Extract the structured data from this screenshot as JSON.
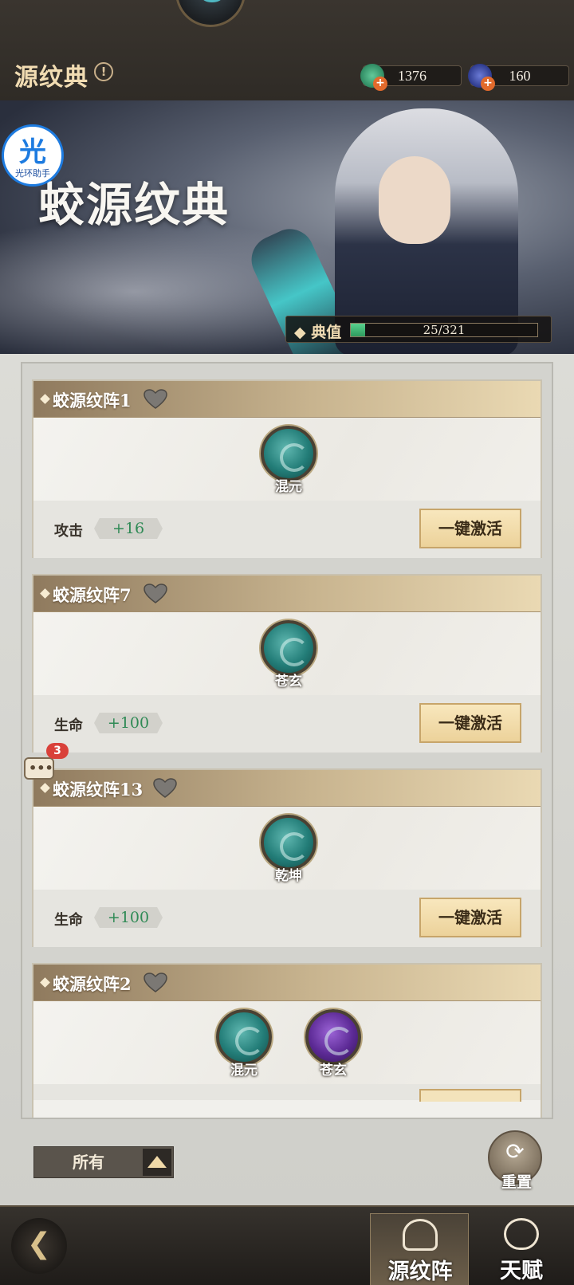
{
  "header": {
    "title": "源纹典",
    "info_icon": "!",
    "currencies": [
      {
        "icon": "jade-coin-icon",
        "value": "1376"
      },
      {
        "icon": "blue-gem-icon",
        "value": "160"
      }
    ],
    "plus_icon": "+"
  },
  "banner": {
    "logo_text": "蛟源纹典",
    "helper_char": "光",
    "helper_label": "光环助手",
    "progress": {
      "label": "典值",
      "current": 25,
      "max": 321,
      "text": "25/321"
    }
  },
  "cards": [
    {
      "title": "蛟源纹阵1",
      "runes": [
        {
          "label": "混元",
          "color": "teal"
        }
      ],
      "stat_label": "攻击",
      "stat_value": "+16",
      "button": "一键激活"
    },
    {
      "title": "蛟源纹阵7",
      "runes": [
        {
          "label": "苍玄",
          "color": "teal"
        }
      ],
      "stat_label": "生命",
      "stat_value": "+100",
      "button": "一键激活"
    },
    {
      "title": "蛟源纹阵13",
      "runes": [
        {
          "label": "乾坤",
          "color": "teal"
        }
      ],
      "stat_label": "生命",
      "stat_value": "+100",
      "button": "一键激活"
    },
    {
      "title": "蛟源纹阵2",
      "runes": [
        {
          "label": "混元",
          "color": "teal"
        },
        {
          "label": "苍玄",
          "color": "purple"
        }
      ]
    }
  ],
  "chat": {
    "dots": "•••",
    "badge": "3"
  },
  "filter": {
    "label": "所有"
  },
  "reset": {
    "glyph": "⟳",
    "label": "重置"
  },
  "nav": {
    "back_glyph": "❮",
    "tabs": [
      {
        "label": "源纹阵",
        "active": true
      },
      {
        "label": "天赋",
        "active": false
      }
    ]
  },
  "colors": {
    "accent_gold": "#ecd29a",
    "stat_green": "#2f8a55",
    "progress_green": "#2e9a5e",
    "teal_rune": "#237d78",
    "purple_rune": "#5c2a95"
  }
}
